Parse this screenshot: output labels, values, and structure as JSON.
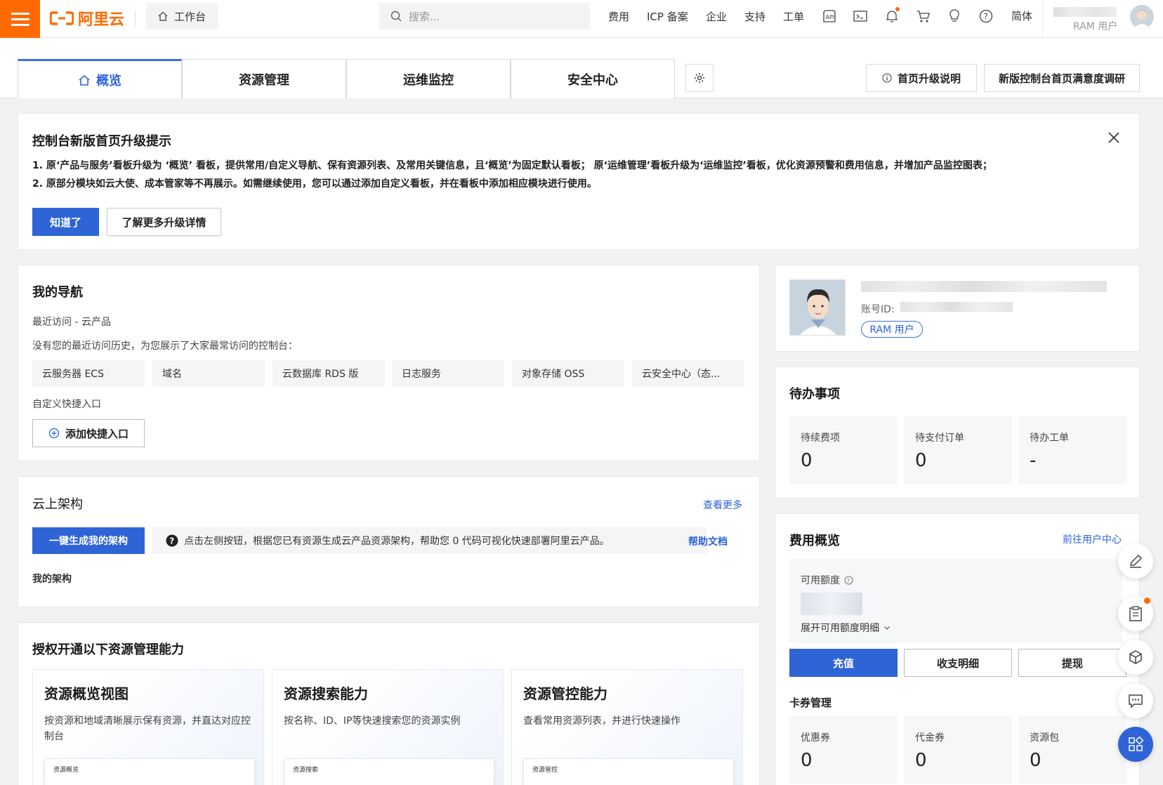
{
  "topbar": {
    "logo_text": "阿里云",
    "workbench_label": "工作台",
    "search_placeholder": "搜索...",
    "nav": [
      "费用",
      "ICP 备案",
      "企业",
      "支持",
      "工单"
    ],
    "language": "简体",
    "account_type": "RAM 用户",
    "accent_color": "#ff6a00"
  },
  "tabs": {
    "items": [
      "概览",
      "资源管理",
      "运维监控",
      "安全中心"
    ],
    "active": "概览",
    "upgrade_notes_label": "首页升级说明",
    "survey_label": "新版控制台首页满意度调研"
  },
  "notice": {
    "title": "控制台新版首页升级提示",
    "line1": "1. 原‘产品与服务’看板升级为 ‘概览’ 看板，提供常用/自定义导航、保有资源列表、及常用关键信息，且‘概览’为固定默认看板； 原‘运维管理’看板升级为‘运维监控’看板，优化资源预警和费用信息，并增加产品监控图表；",
    "line2": "2. 原部分模块如云大使、成本管家等不再展示。如需继续使用，您可以通过添加自定义看板，并在看板中添加相应模块进行使用。",
    "ok_button": "知道了",
    "more_button": "了解更多升级详情"
  },
  "my_nav": {
    "title": "我的导航",
    "recent_label": "最近访问 - 云产品",
    "no_history_text": "没有您的最近访问历史，为您展示了大家最常访问的控制台：",
    "products": [
      "云服务器 ECS",
      "域名",
      "云数据库 RDS 版",
      "日志服务",
      "对象存储 OSS",
      "云安全中心（态..."
    ],
    "custom_label": "自定义快捷入口",
    "add_button": "添加快捷入口"
  },
  "architecture": {
    "title": "云上架构",
    "more_link": "查看更多",
    "generate_button": "一键生成我的架构",
    "hint": "点击左侧按钮，根据您已有资源生成云产品资源架构，帮助您 0 代码可视化快速部署阿里云产品。",
    "help_link": "帮助文档",
    "my_arch_label": "我的架构"
  },
  "capabilities": {
    "title": "授权开通以下资源管理能力",
    "items": [
      {
        "title": "资源概览视图",
        "desc": "按资源和地域清晰展示保有资源，并直达对应控制台",
        "thumb": "资源概览"
      },
      {
        "title": "资源搜索能力",
        "desc": "按名称、ID、IP等快速搜索您的资源实例",
        "thumb": "资源搜索"
      },
      {
        "title": "资源管控能力",
        "desc": "查看常用资源列表，并进行快速操作",
        "thumb": "资源管控"
      }
    ]
  },
  "profile": {
    "account_id_label": "账号ID:",
    "ram_tag": "RAM 用户"
  },
  "todo": {
    "title": "待办事项",
    "items": [
      {
        "label": "待续费项",
        "value": "0"
      },
      {
        "label": "待支付订单",
        "value": "0"
      },
      {
        "label": "待办工单",
        "value": "-"
      }
    ]
  },
  "fees": {
    "title": "费用概览",
    "user_center_link": "前往用户中心",
    "available_label": "可用额度",
    "expand_label": "展开可用额度明细",
    "recharge_button": "充值",
    "detail_button": "收支明细",
    "withdraw_button": "提现",
    "coupon_title": "卡券管理",
    "coupons": [
      {
        "label": "优惠券",
        "value": "0"
      },
      {
        "label": "代金券",
        "value": "0"
      },
      {
        "label": "资源包",
        "value": "0"
      }
    ]
  },
  "colors": {
    "primary": "#2f64d6",
    "link": "#2b63e0",
    "brand": "#ff6a00"
  }
}
